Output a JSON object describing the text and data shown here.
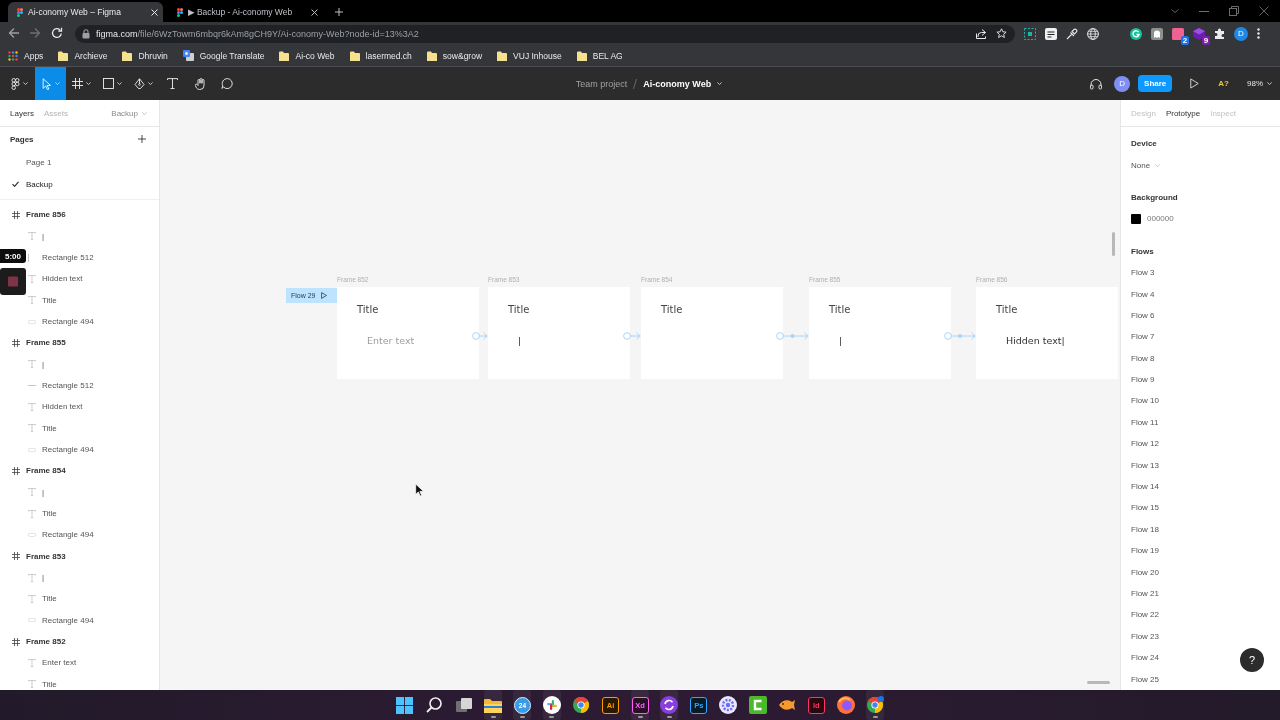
{
  "browser": {
    "tabs": [
      {
        "title": "Ai-conomy Web – Figma",
        "selected": true
      },
      {
        "title": "▶ Backup - Ai-conomy Web",
        "selected": false
      }
    ],
    "address": {
      "domain": "figma.com",
      "path": "/file/6WzTowm6mbqr6kAm8gCH9Y/Ai-conomy-Web?node-id=13%3A2"
    },
    "extensions": [
      {
        "kind": "notes"
      },
      {
        "kind": "shortcut"
      },
      {
        "kind": "picker"
      },
      {
        "kind": "globe"
      },
      {
        "kind": "grammar"
      },
      {
        "kind": "ghost"
      },
      {
        "kind": "pink",
        "badge": "2"
      },
      {
        "kind": "stack",
        "badge": "9"
      },
      {
        "kind": "puzzle"
      }
    ],
    "profile": "D",
    "bookmarks": [
      {
        "label": "Apps",
        "kind": "apps"
      },
      {
        "label": "Archieve",
        "kind": "folder"
      },
      {
        "label": "Dhruvin",
        "kind": "folder"
      },
      {
        "label": "Google Translate",
        "kind": "translate"
      },
      {
        "label": "Ai-co Web",
        "kind": "folder"
      },
      {
        "label": "lasermed.ch",
        "kind": "folder"
      },
      {
        "label": "sow&grow",
        "kind": "folder"
      },
      {
        "label": "VUJ Inhouse",
        "kind": "folder"
      },
      {
        "label": "BEL AG",
        "kind": "folder"
      }
    ]
  },
  "toolbar": {
    "tools": [
      {
        "kind": "main-menu",
        "selected": false,
        "dropdown": true
      },
      {
        "kind": "move",
        "selected": true,
        "dropdown": true
      },
      {
        "kind": "frame",
        "selected": false,
        "dropdown": true
      },
      {
        "kind": "shape",
        "selected": false,
        "dropdown": true
      },
      {
        "kind": "pen",
        "selected": false,
        "dropdown": true
      },
      {
        "kind": "text",
        "selected": false,
        "dropdown": false
      },
      {
        "kind": "hand",
        "selected": false,
        "dropdown": false
      },
      {
        "kind": "comment",
        "selected": false,
        "dropdown": false
      }
    ],
    "team": "Team project",
    "file": "Ai-conomy Web",
    "avatar": "D",
    "share": "Share",
    "font_notice": "A?",
    "zoom": "98%"
  },
  "layers_panel": {
    "tabs": [
      {
        "label": "Layers",
        "selected": true
      },
      {
        "label": "Assets",
        "selected": false
      }
    ],
    "page_switcher": "Backup",
    "pages_heading": "Pages",
    "pages": [
      {
        "name": "Page 1",
        "selected": false
      },
      {
        "name": "Backup",
        "selected": true
      }
    ],
    "layers": [
      {
        "name": "Frame 856",
        "kind": "frame",
        "children": [
          {
            "name": "|",
            "kind": "text"
          },
          {
            "name": "Rectangle 512",
            "kind": "vline"
          },
          {
            "name": "Hidden text",
            "kind": "text"
          },
          {
            "name": "Title",
            "kind": "text"
          },
          {
            "name": "Rectangle 494",
            "kind": "rect"
          }
        ]
      },
      {
        "name": "Frame 855",
        "kind": "frame",
        "children": [
          {
            "name": "|",
            "kind": "text"
          },
          {
            "name": "Rectangle 512",
            "kind": "line"
          },
          {
            "name": "Hidden text",
            "kind": "text"
          },
          {
            "name": "Title",
            "kind": "text"
          },
          {
            "name": "Rectangle 494",
            "kind": "rect"
          }
        ]
      },
      {
        "name": "Frame 854",
        "kind": "frame",
        "children": [
          {
            "name": "|",
            "kind": "text"
          },
          {
            "name": "Title",
            "kind": "text"
          },
          {
            "name": "Rectangle 494",
            "kind": "rect"
          }
        ]
      },
      {
        "name": "Frame 853",
        "kind": "frame",
        "children": [
          {
            "name": "|",
            "kind": "text"
          },
          {
            "name": "Title",
            "kind": "text"
          },
          {
            "name": "Rectangle 494",
            "kind": "rect"
          }
        ]
      },
      {
        "name": "Frame 852",
        "kind": "frame",
        "children": [
          {
            "name": "Enter text",
            "kind": "text"
          },
          {
            "name": "Title",
            "kind": "text"
          }
        ]
      }
    ]
  },
  "canvas": {
    "flow_start": "Flow 29",
    "frames": [
      {
        "name": "Frame 852",
        "title": "Title",
        "input": {
          "placeholder": "Enter text"
        }
      },
      {
        "name": "Frame 853",
        "title": "Title",
        "input": {
          "value": "|"
        }
      },
      {
        "name": "Frame 854",
        "title": "Title"
      },
      {
        "name": "Frame 855",
        "title": "Title",
        "input": {
          "value": "|"
        }
      },
      {
        "name": "Frame 856",
        "title": "Title",
        "input": {
          "value": "Hidden text|"
        }
      }
    ],
    "connections": [
      {
        "kind": "simple"
      },
      {
        "kind": "simple"
      },
      {
        "kind": "waypoint"
      },
      {
        "kind": "waypoint"
      }
    ]
  },
  "prototype_panel": {
    "tabs": [
      {
        "label": "Design",
        "selected": false
      },
      {
        "label": "Prototype",
        "selected": true
      },
      {
        "label": "Inspect",
        "selected": false
      }
    ],
    "device_heading": "Device",
    "device": "None",
    "background_heading": "Background",
    "background": "000000",
    "flows_heading": "Flows",
    "flows": [
      "Flow 3",
      "Flow 4",
      "Flow 6",
      "Flow 7",
      "Flow 8",
      "Flow 9",
      "Flow 10",
      "Flow 11",
      "Flow 12",
      "Flow 13",
      "Flow 14",
      "Flow 15",
      "Flow 18",
      "Flow 19",
      "Flow 20",
      "Flow 21",
      "Flow 22",
      "Flow 23",
      "Flow 24",
      "Flow 25"
    ]
  },
  "help": "?",
  "timer": {
    "time": "5:00"
  },
  "taskbar": {
    "apps": [
      {
        "kind": "start",
        "running": false
      },
      {
        "kind": "search",
        "running": false
      },
      {
        "kind": "taskview",
        "running": false
      },
      {
        "kind": "files",
        "running": true
      },
      {
        "kind": "calendar",
        "label": "24",
        "running": true
      },
      {
        "kind": "slack",
        "running": true
      },
      {
        "kind": "chrome",
        "running": false
      },
      {
        "kind": "tile",
        "label": "Ai",
        "color": "#ff9a00",
        "running": false
      },
      {
        "kind": "tile",
        "label": "Xd",
        "color": "#ff61f6",
        "running": true
      },
      {
        "kind": "sync",
        "running": true
      },
      {
        "kind": "tile",
        "label": "Ps",
        "color": "#31a8ff",
        "running": false
      },
      {
        "kind": "gear",
        "running": false
      },
      {
        "kind": "bracket",
        "running": false
      },
      {
        "kind": "fish",
        "running": false
      },
      {
        "kind": "tile",
        "label": "Id",
        "color": "#ff3366",
        "running": false
      },
      {
        "kind": "firefox",
        "running": false
      },
      {
        "kind": "chrome-profile",
        "running": true
      }
    ]
  }
}
